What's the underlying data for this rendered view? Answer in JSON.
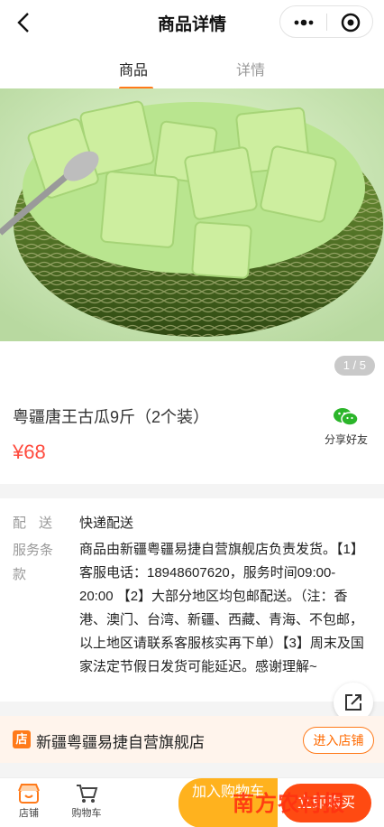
{
  "header": {
    "title": "商品详情"
  },
  "tabs": [
    {
      "label": "商品"
    },
    {
      "label": "详情"
    }
  ],
  "gallery": {
    "counter": "1 / 5"
  },
  "product": {
    "name": "粤疆唐王古瓜9斤（2个装）",
    "price": "¥68"
  },
  "share": {
    "label": "分享好友"
  },
  "delivery": {
    "label": "配送",
    "value": "快递配送"
  },
  "service": {
    "label": "服务条款",
    "text": "商品由新疆粤疆易捷自营旗舰店负责发货。【1】客服电话：18948607620，服务时间09:00-20:00 【2】大部分地区均包邮配送。（注：香港、澳门、台湾、新疆、西藏、青海、不包邮，以上地区请联系客服核实再下单）【3】周末及国家法定节假日发货可能延迟。感谢理解~"
  },
  "store": {
    "icon_text": "店",
    "name": "新疆粤疆易捷自营旗舰店",
    "enter_label": "进入店铺"
  },
  "bottom_nav": {
    "store_label": "店铺",
    "cart_label": "购物车",
    "add_cart_label": "加入购物车",
    "buy_label": "立即购买"
  },
  "watermark": "南方农村报",
  "colors": {
    "accent": "#ff7a1a",
    "price": "#ff4a3d",
    "add_cart": "#ffb21e",
    "buy": "#ff4a12"
  },
  "icons": [
    "back-icon",
    "more-icon",
    "close-target-icon",
    "wechat-icon",
    "share-link-icon",
    "store-icon",
    "cart-icon"
  ]
}
